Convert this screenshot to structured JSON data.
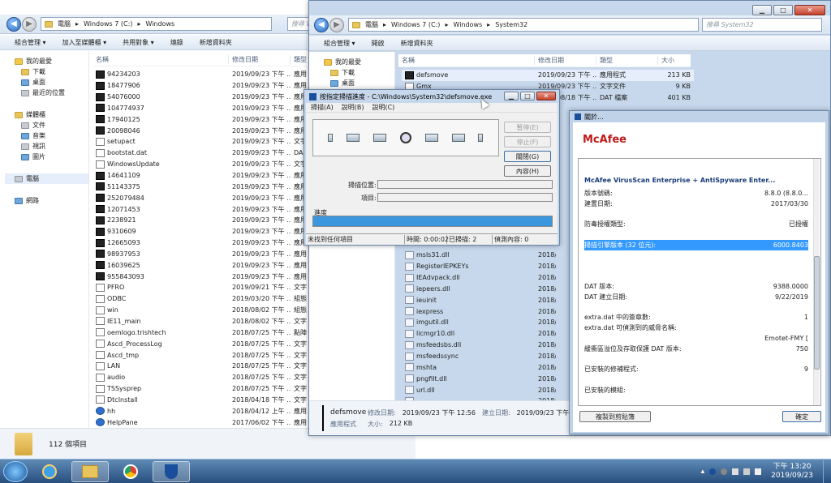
{
  "left_explorer": {
    "path": [
      "電腦",
      "Windows 7 (C:)",
      "Windows"
    ],
    "search_placeholder": "搜尋 Windows",
    "toolbar": [
      "組合管理 ▾",
      "加入至媒體櫃 ▾",
      "共用對象 ▾",
      "燒錄",
      "新增資料夾"
    ],
    "sidebar": {
      "favorites_header": "我的最愛",
      "favorites": [
        "下載",
        "桌面",
        "最近的位置"
      ],
      "libraries_header": "媒體櫃",
      "libraries": [
        "文件",
        "音樂",
        "視訊",
        "圖片"
      ],
      "computer": "電腦",
      "network": "網路"
    },
    "columns": [
      "名稱",
      "修改日期",
      "類型"
    ],
    "files": [
      {
        "name": "94234203",
        "date": "2019/09/23 下午 ...",
        "type": "應用",
        "icon": "exe"
      },
      {
        "name": "18477906",
        "date": "2019/09/23 下午 ...",
        "type": "應用",
        "icon": "exe"
      },
      {
        "name": "54076000",
        "date": "2019/09/23 下午 ...",
        "type": "應用",
        "icon": "exe"
      },
      {
        "name": "104774937",
        "date": "2019/09/23 下午 ...",
        "type": "應用",
        "icon": "exe"
      },
      {
        "name": "17940125",
        "date": "2019/09/23 下午 ...",
        "type": "應用",
        "icon": "exe"
      },
      {
        "name": "20098046",
        "date": "2019/09/23 下午 ...",
        "type": "應用",
        "icon": "exe"
      },
      {
        "name": "setupact",
        "date": "2019/09/23 下午 ...",
        "type": "文字",
        "icon": "doc"
      },
      {
        "name": "bootstat.dat",
        "date": "2019/09/23 下午 ...",
        "type": "DA",
        "icon": "doc"
      },
      {
        "name": "WindowsUpdate",
        "date": "2019/09/23 下午 ...",
        "type": "文字",
        "icon": "doc"
      },
      {
        "name": "14641109",
        "date": "2019/09/23 下午 ...",
        "type": "應用",
        "icon": "exe"
      },
      {
        "name": "51143375",
        "date": "2019/09/23 下午 ...",
        "type": "應用",
        "icon": "exe"
      },
      {
        "name": "252079484",
        "date": "2019/09/23 下午 ...",
        "type": "應用",
        "icon": "exe"
      },
      {
        "name": "12071453",
        "date": "2019/09/23 下午 ...",
        "type": "應用",
        "icon": "exe"
      },
      {
        "name": "2238921",
        "date": "2019/09/23 下午 ...",
        "type": "應用",
        "icon": "exe"
      },
      {
        "name": "9310609",
        "date": "2019/09/23 下午 ...",
        "type": "應用",
        "icon": "exe"
      },
      {
        "name": "12665093",
        "date": "2019/09/23 下午 ...",
        "type": "應用",
        "icon": "exe"
      },
      {
        "name": "98937953",
        "date": "2019/09/23 下午 ...",
        "type": "應用",
        "icon": "exe"
      },
      {
        "name": "16039625",
        "date": "2019/09/23 下午 ...",
        "type": "應用",
        "icon": "exe"
      },
      {
        "name": "955843093",
        "date": "2019/09/23 下午 ...",
        "type": "應用",
        "icon": "exe"
      },
      {
        "name": "PFRO",
        "date": "2019/09/21 下午 ...",
        "type": "文字",
        "icon": "doc"
      },
      {
        "name": "ODBC",
        "date": "2019/03/20 下午 ...",
        "type": "組態",
        "icon": "doc"
      },
      {
        "name": "win",
        "date": "2018/08/02 下午 ...",
        "type": "組態",
        "icon": "doc"
      },
      {
        "name": "IE11_main",
        "date": "2018/08/02 下午 ...",
        "type": "文字",
        "icon": "doc"
      },
      {
        "name": "oemlogo.trishtech",
        "date": "2018/07/25 下午 ...",
        "type": "點陣",
        "icon": "doc"
      },
      {
        "name": "Ascd_ProcessLog",
        "date": "2018/07/25 下午 ...",
        "type": "文字",
        "icon": "doc"
      },
      {
        "name": "Ascd_tmp",
        "date": "2018/07/25 下午 ...",
        "type": "文字",
        "icon": "doc"
      },
      {
        "name": "LAN",
        "date": "2018/07/25 下午 ...",
        "type": "文字",
        "icon": "doc"
      },
      {
        "name": "audio",
        "date": "2018/07/25 下午 ...",
        "type": "文字",
        "icon": "doc"
      },
      {
        "name": "TSSysprep",
        "date": "2018/07/25 下午 ...",
        "type": "文字",
        "icon": "doc"
      },
      {
        "name": "DtcInstall",
        "date": "2018/04/18 下午 ...",
        "type": "文字",
        "icon": "doc"
      },
      {
        "name": "hh",
        "date": "2018/04/12 上午 ...",
        "type": "應用",
        "icon": "help"
      },
      {
        "name": "HelpPane",
        "date": "2017/06/02 下午 ...",
        "type": "應用",
        "icon": "help"
      }
    ],
    "item_count": "112 個項目"
  },
  "right_explorer": {
    "path": [
      "電腦",
      "Windows 7 (C:)",
      "Windows",
      "System32"
    ],
    "search_placeholder": "搜尋 System32",
    "toolbar": [
      "組合管理 ▾",
      "開啟",
      "新增資料夾"
    ],
    "sidebar": {
      "favorites_header": "我的最愛",
      "favorites": [
        "下載",
        "桌面"
      ]
    },
    "columns": [
      "名稱",
      "修改日期",
      "類型",
      "大小"
    ],
    "top_files": [
      {
        "name": "defsmove",
        "date": "2019/09/23 下午 ...",
        "type": "應用程式",
        "size": "213 KB",
        "icon": "exe"
      },
      {
        "name": "Gmx",
        "date": "2019/09/23 下午 ...",
        "type": "文字文件",
        "size": "9 KB",
        "icon": "doc"
      },
      {
        "name": "",
        "date": "2018/08/18 下午 ...",
        "type": "DAT 檔案",
        "size": "401 KB",
        "icon": "doc"
      },
      {
        "name": "",
        "date": "",
        "type": "",
        "size": "",
        "icon": "doc"
      }
    ],
    "files": [
      {
        "name": "msls31.dll",
        "date": "2018/08/0",
        "icon": "dll"
      },
      {
        "name": "RegisterIEPKEYs",
        "date": "2018/08/0",
        "icon": "dll"
      },
      {
        "name": "IEAdvpack.dll",
        "date": "2018/08/0",
        "icon": "dll"
      },
      {
        "name": "iepeers.dll",
        "date": "2018/08/0",
        "icon": "dll"
      },
      {
        "name": "ieuinit",
        "date": "2018/08/0",
        "icon": "dll"
      },
      {
        "name": "iexpress",
        "date": "2018/08/0",
        "icon": "dll"
      },
      {
        "name": "imgutil.dll",
        "date": "2018/08/0",
        "icon": "dll"
      },
      {
        "name": "licmgr10.dll",
        "date": "2018/08/0",
        "icon": "dll"
      },
      {
        "name": "msfeedsbs.dll",
        "date": "2018/08/0",
        "icon": "dll"
      },
      {
        "name": "msfeedssync",
        "date": "2018/08/0",
        "icon": "dll"
      },
      {
        "name": "mshta",
        "date": "2018/08/0",
        "icon": "dll"
      },
      {
        "name": "pngfilt.dll",
        "date": "2018/08/0",
        "icon": "dll"
      },
      {
        "name": "url.dll",
        "date": "2018/08/0",
        "icon": "dll"
      },
      {
        "name": "",
        "date": "2018/08/0",
        "icon": "dll"
      }
    ],
    "details": {
      "name": "defsmove",
      "type": "應用程式",
      "modified_label": "修改日期:",
      "modified": "2019/09/23 下午 12:56",
      "created_label": "建立日期:",
      "created": "2019/09/23 下午 ...",
      "size_label": "大小:",
      "size": "212 KB"
    }
  },
  "scan_dialog": {
    "title": "按指定掃描進度 - C:\\Windows\\System32\\defsmove.exe",
    "menu": [
      "掃描(A)",
      "說明(B)",
      "說明(C)"
    ],
    "buttons": {
      "pause": "暫停(E)",
      "stop": "停止(F)",
      "close": "關閉(G)",
      "detail": "內容(H)"
    },
    "scan_location_label": "掃描位置:",
    "item_label": "項目:",
    "progress_label": "進度",
    "progress_fraction": 1.0,
    "status": {
      "message": "未找到任何項目",
      "time": "時間: 0:00:02",
      "scanned": "已掃描: 2",
      "detected": "偵測內容: 0"
    }
  },
  "about_dialog": {
    "title": "關於...",
    "brand": "McAfee",
    "product": "McAfee VirusScan Enterprise + AntiSpyware Enter...",
    "rows": [
      {
        "label": "版本號碼:",
        "value": "8.8.0 (8.8.0..."
      },
      {
        "label": "建置日期:",
        "value": "2017/03/30"
      },
      {
        "label": "",
        "value": ""
      },
      {
        "label": "防毒授權類型:",
        "value": "已授權"
      },
      {
        "label": "",
        "value": ""
      },
      {
        "label": "掃描引擎版本 (32 位元):",
        "value": "6000.8403",
        "selected": true
      },
      {
        "label": "",
        "value": ""
      },
      {
        "label": "",
        "value": ""
      },
      {
        "label": "",
        "value": ""
      },
      {
        "label": "DAT 版本:",
        "value": "9388.0000"
      },
      {
        "label": "DAT 建立日期:",
        "value": "9/22/2019"
      },
      {
        "label": "",
        "value": ""
      },
      {
        "label": "extra.dat 中的簽章數:",
        "value": "1"
      },
      {
        "label": "extra.dat 可偵測到的威脅名稱:",
        "value": ""
      },
      {
        "label": "",
        "value": "Emotet-FMY ["
      },
      {
        "label": "緩衝區溢位及存取保護 DAT 版本:",
        "value": "750"
      },
      {
        "label": "",
        "value": ""
      },
      {
        "label": "已安裝的修補程式:",
        "value": "9"
      },
      {
        "label": "",
        "value": ""
      },
      {
        "label": "已安裝的模組:",
        "value": ""
      }
    ],
    "copy_button": "複製到剪貼簿",
    "ok_button": "確定"
  },
  "taskbar": {
    "time": "下午 13:20",
    "date": "2019/09/23"
  },
  "colors": {
    "progress": "#3a96dd",
    "selected_row": "#3399ff",
    "mcafee_red": "#c01818"
  }
}
